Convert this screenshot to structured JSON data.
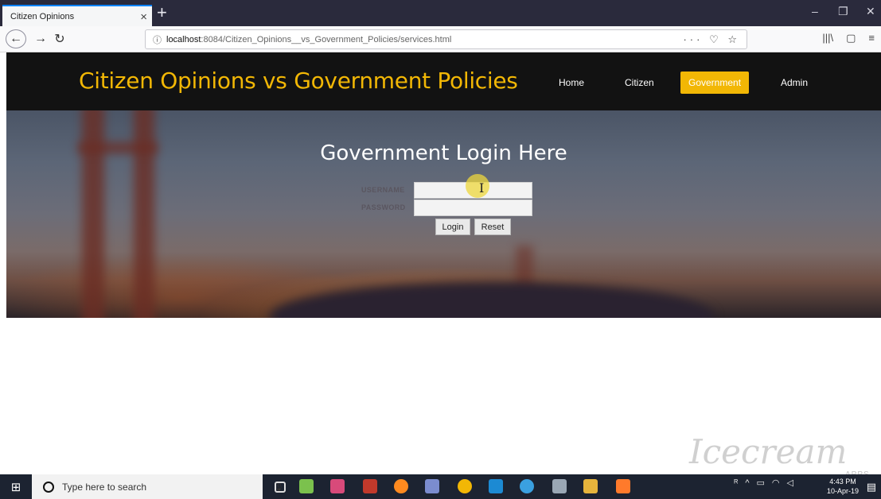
{
  "browser": {
    "tab_title": "Citizen Opinions",
    "tab_close": "×",
    "new_tab": "+",
    "url_host": "localhost",
    "url_path": ":8084/Citizen_Opinions__vs_Government_Policies/services.html",
    "url_actions": "··· ♡ ☆",
    "window_controls": [
      "–",
      "❐",
      "✕"
    ],
    "icons": [
      "back-icon",
      "forward-icon",
      "reload-icon",
      "info-icon",
      "library-icon",
      "sidebar-icon",
      "menu-icon"
    ]
  },
  "site": {
    "title": "Citizen Opinions vs Government Policies",
    "nav": [
      "Home",
      "Citizen",
      "Government",
      "Admin"
    ],
    "active_nav": "Government",
    "accent_color": "#f2b705",
    "header_color": "#121212"
  },
  "login": {
    "heading": "Government Login Here",
    "username_label": "USERNAME",
    "password_label": "PASSWORD",
    "username_value": "",
    "password_value": "",
    "login_button": "Login",
    "reset_button": "Reset"
  },
  "watermark": {
    "text": "Icecream",
    "sub": "APPS"
  },
  "taskbar": {
    "search_placeholder": "Type here to search",
    "time": "4:43 PM",
    "date": "10-Apr-19",
    "apps": [
      "task-view-icon",
      "image-app-icon",
      "paint-app-icon",
      "ruby-app-icon",
      "firefox-icon",
      "netbeans-icon",
      "chrome-icon",
      "virtualbox-icon",
      "network-app-icon",
      "camera-app-icon",
      "file-explorer-icon",
      "recorder-icon"
    ]
  }
}
